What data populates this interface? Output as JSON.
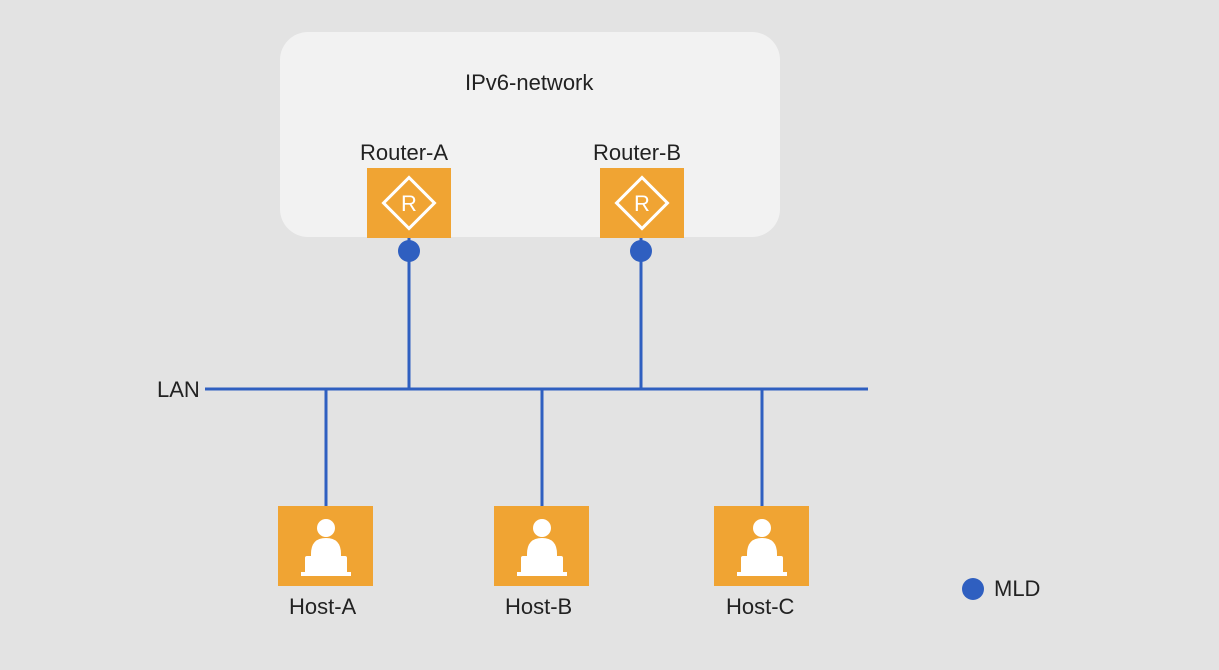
{
  "network": {
    "title": "IPv6-network"
  },
  "routers": {
    "a": {
      "label": "Router-A"
    },
    "b": {
      "label": "Router-B"
    }
  },
  "lan": {
    "label": "LAN"
  },
  "hosts": {
    "a": {
      "label": "Host-A"
    },
    "b": {
      "label": "Host-B"
    },
    "c": {
      "label": "Host-C"
    }
  },
  "legend": {
    "mld": "MLD"
  },
  "colors": {
    "line": "#2f5fc0",
    "node": "#f0a433",
    "cloud": "#f2f2f2",
    "dot": "#2f5fc0"
  }
}
